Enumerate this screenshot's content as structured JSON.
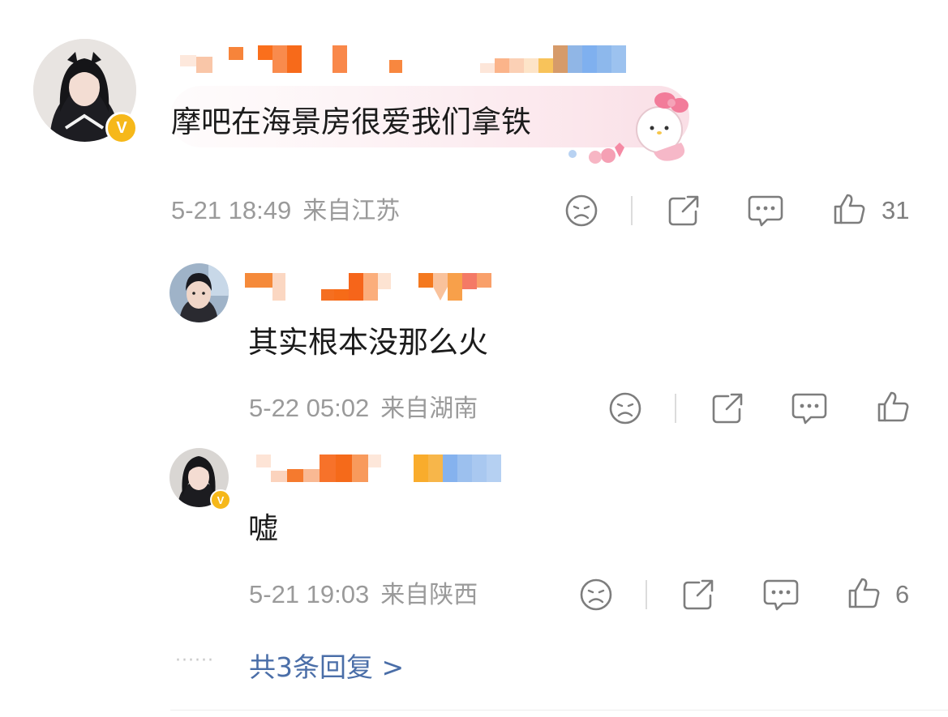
{
  "comment": {
    "text": "摩吧在海景房很爱我们拿铁",
    "time": "5-21 18:49",
    "location": "来自江苏",
    "like_count": "31",
    "badge": "V"
  },
  "replies": [
    {
      "text": "其实根本没那么火",
      "time": "5-22 05:02",
      "location": "来自湖南",
      "like_count": "",
      "badge": ""
    },
    {
      "text": "嘘",
      "time": "5-21 19:03",
      "location": "来自陕西",
      "like_count": "6",
      "badge": "V"
    }
  ],
  "more": {
    "dots": "······",
    "label": "共3条回复 >"
  },
  "colors": {
    "verified_badge": "#f6b81a",
    "link": "#4a6ea8",
    "meta": "#9a9a9a"
  }
}
